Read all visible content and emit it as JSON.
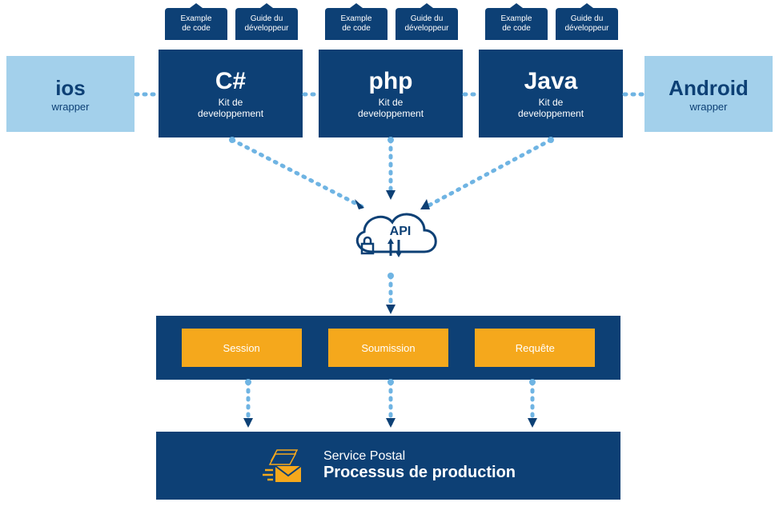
{
  "tabs": {
    "example": "Example\nde code",
    "guide": "Guide du\ndéveloppeur"
  },
  "sdk": {
    "csharp": {
      "title": "C#",
      "sub": "Kit de\ndeveloppement"
    },
    "php": {
      "title": "php",
      "sub": "Kit de\ndeveloppement"
    },
    "java": {
      "title": "Java",
      "sub": "Kit de\ndeveloppement"
    }
  },
  "wrappers": {
    "ios": {
      "title": "ios",
      "sub": "wrapper"
    },
    "android": {
      "title": "Android",
      "sub": "wrapper"
    }
  },
  "api_label": "API",
  "middle": {
    "session": "Session",
    "soumission": "Soumission",
    "requete": "Requête"
  },
  "bottom": {
    "line1": "Service Postal",
    "line2": "Processus de production"
  }
}
